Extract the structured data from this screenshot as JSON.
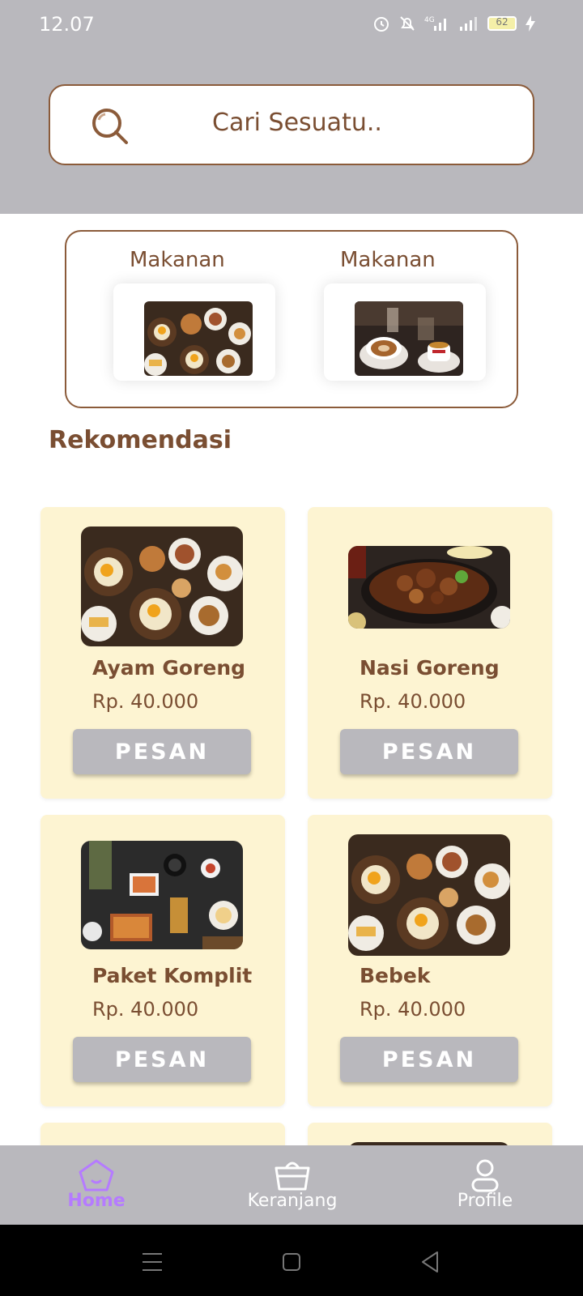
{
  "status_bar": {
    "time": "12.07",
    "network": "4G",
    "battery": "62"
  },
  "search": {
    "placeholder": "Cari Sesuatu.."
  },
  "categories": [
    {
      "label": "Makanan",
      "image": "food-platter-photo"
    },
    {
      "label": "Makanan",
      "image": "coffee-photo"
    }
  ],
  "section_title": "Rekomendasi",
  "products": [
    {
      "name": "Ayam Goreng",
      "price": "Rp. 40.000",
      "button": "PESAN",
      "image": "food-platter-photo"
    },
    {
      "name": "Nasi Goreng",
      "price": "Rp. 40.000",
      "button": "PESAN",
      "image": "sizzling-plate-photo"
    },
    {
      "name": "Paket Komplit",
      "price": "Rp. 40.000",
      "button": "PESAN",
      "image": "table-spread-photo"
    },
    {
      "name": "Bebek",
      "price": "Rp. 40.000",
      "button": "PESAN",
      "image": "food-platter-photo"
    }
  ],
  "bottom_nav": [
    {
      "label": "Home",
      "icon": "home-icon",
      "active": true
    },
    {
      "label": "Keranjang",
      "icon": "basket-icon",
      "active": false
    },
    {
      "label": "Profile",
      "icon": "profile-icon",
      "active": false
    }
  ],
  "colors": {
    "header_bg": "#b9b8bd",
    "brown_accent": "#7a4e32",
    "card_bg": "#fdf4d2",
    "active_nav": "#b57bff"
  }
}
